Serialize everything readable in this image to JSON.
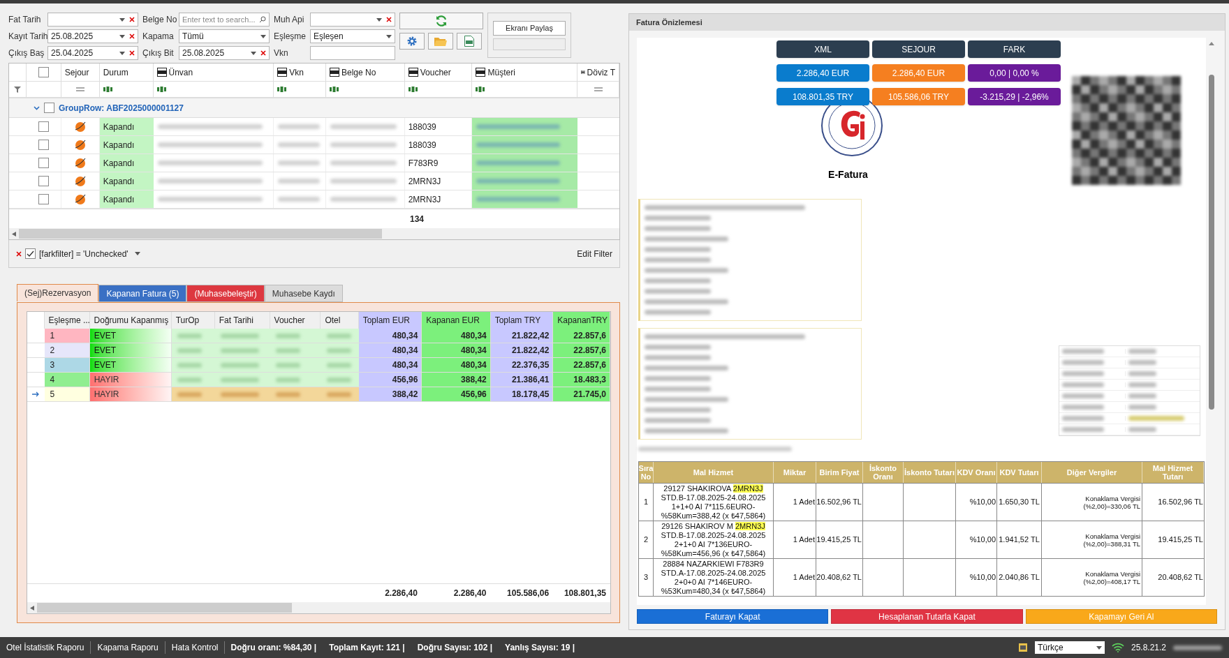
{
  "filters": [
    {
      "label": "Fat Tarih",
      "kind": "combo",
      "clearable": true
    },
    {
      "label": "Belge No",
      "kind": "search",
      "placeholder": "Enter text to search..."
    },
    {
      "label": "Muh Api",
      "kind": "combo",
      "clearable": true
    },
    {
      "label": "Kayıt Tarih",
      "kind": "combo",
      "value": "25.08.2025",
      "clearable": true
    },
    {
      "label": "Kapama",
      "kind": "combo",
      "value": "Tümü",
      "clearable": false
    },
    {
      "label": "Eşleşme",
      "kind": "combo",
      "value": "Eşleşen",
      "clearable": false
    },
    {
      "label": "Çıkış Baş",
      "kind": "combo",
      "value": "25.04.2025",
      "clearable": true
    },
    {
      "label": "Çıkış Bit",
      "kind": "combo",
      "value": "25.08.2025",
      "clearable": true
    },
    {
      "label": "Vkn",
      "kind": "text"
    }
  ],
  "share_button": "Ekranı Paylaş",
  "top_grid": {
    "all_checked": false,
    "columns": [
      {
        "label": "Sejour",
        "xml": false,
        "text_filter": false
      },
      {
        "label": "Durum",
        "xml": false,
        "text_filter": true
      },
      {
        "label": "Ünvan",
        "xml": true,
        "text_filter": true
      },
      {
        "label": "Vkn",
        "xml": true,
        "text_filter": true
      },
      {
        "label": "Belge No",
        "xml": true,
        "text_filter": true
      },
      {
        "label": "Voucher",
        "xml": true,
        "text_filter": true
      },
      {
        "label": "Müşteri",
        "xml": true,
        "text_filter": true
      },
      {
        "label": "Döviz T",
        "xml": true,
        "text_filter": false
      }
    ],
    "group": {
      "label": "GroupRow: ABF2025000001127",
      "expanded": true,
      "checked": false
    },
    "rows": [
      {
        "checked": false,
        "status": "Kapandı",
        "voucher": "188039"
      },
      {
        "checked": false,
        "status": "Kapandı",
        "voucher": "188039"
      },
      {
        "checked": false,
        "status": "Kapandı",
        "voucher": "F783R9"
      },
      {
        "checked": false,
        "status": "Kapandı",
        "voucher": "2MRN3J"
      },
      {
        "checked": false,
        "status": "Kapandı",
        "voucher": "2MRN3J"
      }
    ],
    "total": "134"
  },
  "filter_bar": {
    "checked": true,
    "text": "[farkfilter] = 'Unchecked'",
    "edit": "Edit Filter"
  },
  "tabs": [
    {
      "label": "(Sej)Rezervasyon",
      "selected": true,
      "color": "#f8e4db"
    },
    {
      "label": "Kapanan Fatura (5)",
      "selected": false,
      "color": "#3a70c4"
    },
    {
      "label": "(Muhasebeleştir)",
      "selected": false,
      "color": "#dd3840"
    },
    {
      "label": "Muhasebe Kaydı",
      "selected": false,
      "color": "#dcdcdc"
    }
  ],
  "match_grid": {
    "columns": [
      {
        "label": "Eşleşme ...",
        "color": "#f0f0f0"
      },
      {
        "label": "Doğrumu Kapanmış",
        "color": "#f0f0f0"
      },
      {
        "label": "TurOp",
        "color": "#f0f0f0"
      },
      {
        "label": "Fat Tarihi",
        "color": "#f0f0f0"
      },
      {
        "label": "Voucher",
        "color": "#f0f0f0"
      },
      {
        "label": "Otel",
        "color": "#f0f0f0"
      },
      {
        "label": "Toplam EUR",
        "color": "#c8c8ff"
      },
      {
        "label": "Kapanan EUR",
        "color": "#7cf07c"
      },
      {
        "label": "Toplam TRY",
        "color": "#c8c8ff"
      },
      {
        "label": "KapananTRY",
        "color": "#7cf07c"
      }
    ],
    "rows": [
      {
        "no": "1",
        "color": "#ffb6c1",
        "status": "EVET",
        "ok": true,
        "selected": false,
        "values": [
          "480,34",
          "480,34",
          "21.822,42",
          "22.857,6"
        ]
      },
      {
        "no": "2",
        "color": "#e6e6fa",
        "status": "EVET",
        "ok": true,
        "selected": false,
        "values": [
          "480,34",
          "480,34",
          "21.822,42",
          "22.857,6"
        ]
      },
      {
        "no": "3",
        "color": "#add8e6",
        "status": "EVET",
        "ok": true,
        "selected": false,
        "values": [
          "480,34",
          "480,34",
          "22.376,35",
          "22.857,6"
        ]
      },
      {
        "no": "4",
        "color": "#90ee90",
        "status": "HAYIR",
        "ok": false,
        "selected": false,
        "values": [
          "456,96",
          "388,42",
          "21.386,41",
          "18.483,3"
        ]
      },
      {
        "no": "5",
        "color": "#ffffe0",
        "status": "HAYIR",
        "ok": false,
        "selected": true,
        "values": [
          "388,42",
          "456,96",
          "18.178,45",
          "21.745,0"
        ]
      }
    ],
    "totals": [
      "2.286,40",
      "2.286,40",
      "105.586,06",
      "108.801,35"
    ]
  },
  "preview": {
    "title": "Fatura Önizlemesi",
    "summary": {
      "columns": [
        {
          "label": "XML",
          "color": "#0a7ccd"
        },
        {
          "label": "SEJOUR",
          "color": "#f57f20"
        },
        {
          "label": "FARK",
          "color": "#6a1b9a"
        }
      ],
      "rows": [
        [
          "2.286,40 EUR",
          "2.286,40 EUR",
          "0,00 | 0,00 %"
        ],
        [
          "108.801,35 TRY",
          "105.586,06 TRY",
          "-3.215,29 | -2,96%"
        ]
      ]
    },
    "doc_title": "E-Fatura",
    "table": {
      "columns": [
        "Sıra No",
        "Mal Hizmet",
        "Miktar",
        "Birim Fiyat",
        "İskonto Oranı",
        "İskonto Tutarı",
        "KDV Oranı",
        "KDV Tutarı",
        "Diğer Vergiler",
        "Mal Hizmet Tutarı"
      ],
      "rows": [
        {
          "no": "1",
          "name": "29127 SHAKIROVA",
          "code": "2MRN3J",
          "highlighted": true,
          "detail": "STD.B-17.08.2025-24.08.2025 1+1+0 AI 7*115.6EURO-%58Kum=388,42 (x ₺47,5864)",
          "qty": "1 Adet",
          "price": "16.502,96 TL",
          "vat_rate": "%10,00",
          "vat": "1.650,30 TL",
          "other": "Konaklama Vergisi (%2,00)=330,06 TL",
          "total": "16.502,96 TL"
        },
        {
          "no": "2",
          "name": "29126 SHAKIROV M",
          "code": "2MRN3J",
          "highlighted": true,
          "detail": "STD.B-17.08.2025-24.08.2025 2+1+0 AI 7*136EURO-%58Kum=456,96 (x ₺47,5864)",
          "qty": "1 Adet",
          "price": "19.415,25 TL",
          "vat_rate": "%10,00",
          "vat": "1.941,52 TL",
          "other": "Konaklama Vergisi (%2,00)=388,31 TL",
          "total": "19.415,25 TL"
        },
        {
          "no": "3",
          "name": "28884 NAZARKIEWI",
          "code": "F783R9",
          "highlighted": false,
          "detail": "STD.A-17.08.2025-24.08.2025 2+0+0 AI 7*146EURO-%53Kum=480,34 (x ₺47,5864)",
          "qty": "1 Adet",
          "price": "20.408,62 TL",
          "vat_rate": "%10,00",
          "vat": "2.040,86 TL",
          "other": "Konaklama Vergisi (%2,00)=408,17 TL",
          "total": "20.408,62 TL"
        }
      ]
    },
    "actions": [
      {
        "label": "Faturayı Kapat",
        "color": "#1a6fd6"
      },
      {
        "label": "Hesaplanan Tutarla Kapat",
        "color": "#e03444"
      },
      {
        "label": "Kapamayı Geri Al",
        "color": "#f9a81a"
      }
    ]
  },
  "status_bar": {
    "items": [
      {
        "label": "Otel İstatistik Raporu",
        "kind": "link"
      },
      {
        "label": "Kapama Raporu",
        "kind": "link"
      },
      {
        "label": "Hata Kontrol",
        "kind": "link"
      },
      {
        "label": "Doğru oranı: %84,30 |",
        "kind": "stat"
      },
      {
        "label": "Toplam Kayıt: 121 |",
        "kind": "stat"
      },
      {
        "label": "Doğru Sayısı: 102 |",
        "kind": "stat"
      },
      {
        "label": "Yanlış Sayısı: 19 |",
        "kind": "stat"
      }
    ],
    "language": "Türkçe",
    "version": "25.8.21.2"
  }
}
